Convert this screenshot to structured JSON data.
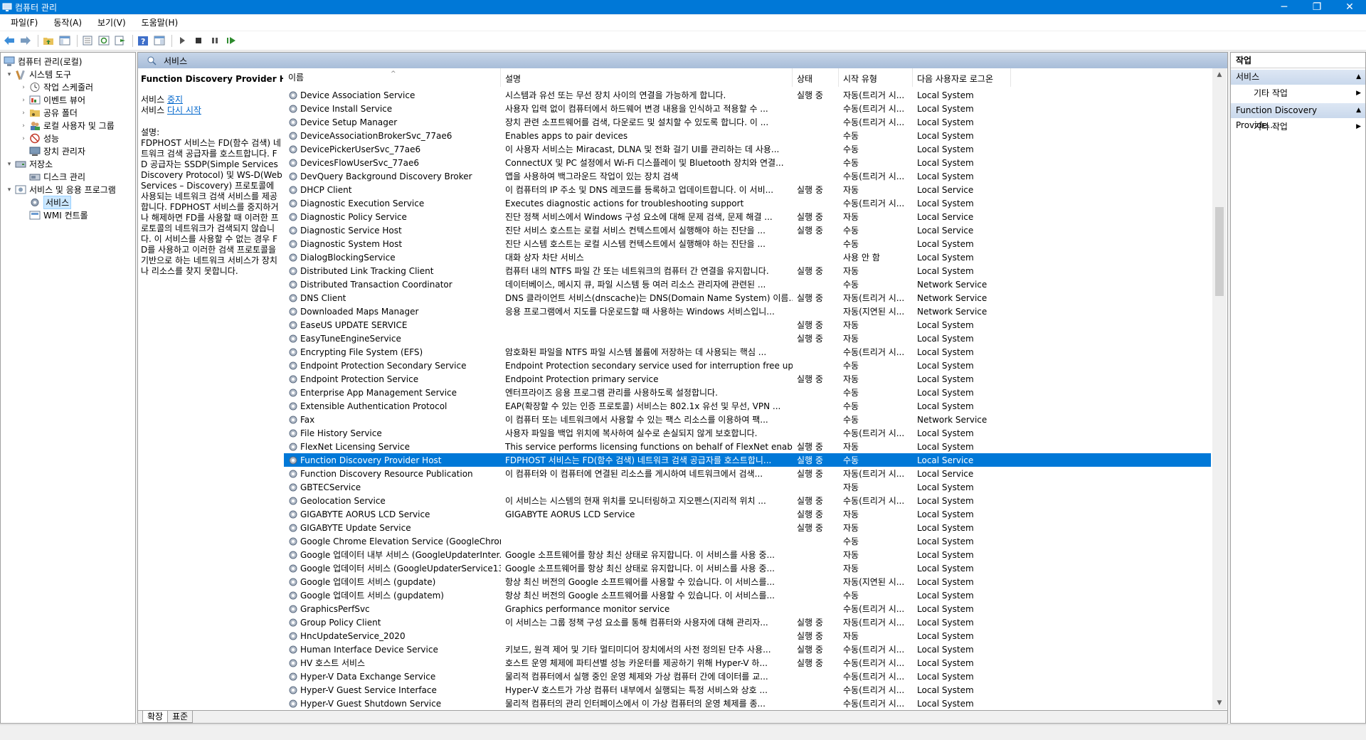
{
  "window": {
    "title": "컴퓨터 관리",
    "minimize": "─",
    "maximize": "❐",
    "close": "✕"
  },
  "menu": [
    "파일(F)",
    "동작(A)",
    "보기(V)",
    "도움말(H)"
  ],
  "tree": {
    "root": "컴퓨터 관리(로컬)",
    "system_tools": "시스템 도구",
    "task_scheduler": "작업 스케줄러",
    "event_viewer": "이벤트 뷰어",
    "shared_folders": "공유 폴더",
    "local_users": "로컬 사용자 및 그룹",
    "performance": "성능",
    "device_manager": "장치 관리자",
    "storage": "저장소",
    "disk_management": "디스크 관리",
    "services_apps": "서비스 및 응용 프로그램",
    "services": "서비스",
    "wmi": "WMI 컨트롤"
  },
  "center": {
    "header": "서비스",
    "selected_service": "Function Discovery Provider Host",
    "action_prefix_1": "서비스 ",
    "action_stop": "중지",
    "action_prefix_2": "서비스 ",
    "action_restart": "다시 시작",
    "desc_label": "설명:",
    "desc_text": "FDPHOST 서비스는 FD(함수 검색) 네트워크 검색 공급자를 호스트합니다. FD 공급자는 SSDP(Simple Services Discovery Protocol) 및 WS-D(Web Services – Discovery) 프로토콜에 사용되는 네트워크 검색 서비스를 제공합니다. FDPHOST 서비스를 중지하거나 해제하면 FD를 사용할 때 이러한 프로토콜의 네트워크가 검색되지 않습니다. 이 서비스를 사용할 수 없는 경우 FD를 사용하고 이러한 검색 프로토콜을 기반으로 하는 네트워크 서비스가 장치나 리소스를 찾지 못합니다.",
    "columns": [
      "이름",
      "설명",
      "상태",
      "시작 유형",
      "다음 사용자로 로그온"
    ],
    "sort_arrow": "^",
    "tabs": [
      "확장",
      "표준"
    ]
  },
  "services": [
    {
      "name": "Device Association Service",
      "desc": "시스템과 유선 또는 무선 장치 사이의 연결을 가능하게 합니다.",
      "status": "실행 중",
      "start": "자동(트리거 시...",
      "logon": "Local System"
    },
    {
      "name": "Device Install Service",
      "desc": "사용자 입력 없이 컴퓨터에서 하드웨어 변경 내용을 인식하고 적용할 수 ...",
      "status": "",
      "start": "수동(트리거 시...",
      "logon": "Local System"
    },
    {
      "name": "Device Setup Manager",
      "desc": "장치 관련 소프트웨어를 검색, 다운로드 및 설치할 수 있도록 합니다. 이 ...",
      "status": "",
      "start": "수동(트리거 시...",
      "logon": "Local System"
    },
    {
      "name": "DeviceAssociationBrokerSvc_77ae6",
      "desc": "Enables apps to pair devices",
      "status": "",
      "start": "수동",
      "logon": "Local System"
    },
    {
      "name": "DevicePickerUserSvc_77ae6",
      "desc": "이 사용자 서비스는 Miracast, DLNA 및 전화 걸기 UI를 관리하는 데 사용...",
      "status": "",
      "start": "수동",
      "logon": "Local System"
    },
    {
      "name": "DevicesFlowUserSvc_77ae6",
      "desc": "ConnectUX 및 PC 설정에서 Wi-Fi 디스플레이 및 Bluetooth 장치와 연결...",
      "status": "",
      "start": "수동",
      "logon": "Local System"
    },
    {
      "name": "DevQuery Background Discovery Broker",
      "desc": "앱을 사용하여 백그라운드 작업이 있는 장치 검색",
      "status": "",
      "start": "수동(트리거 시...",
      "logon": "Local System"
    },
    {
      "name": "DHCP Client",
      "desc": "이 컴퓨터의 IP 주소 및 DNS 레코드를 등록하고 업데이트합니다. 이 서비...",
      "status": "실행 중",
      "start": "자동",
      "logon": "Local Service"
    },
    {
      "name": "Diagnostic Execution Service",
      "desc": "Executes diagnostic actions for troubleshooting support",
      "status": "",
      "start": "수동(트리거 시...",
      "logon": "Local System"
    },
    {
      "name": "Diagnostic Policy Service",
      "desc": "진단 정책 서비스에서 Windows 구성 요소에 대해 문제 검색, 문제 해결 ...",
      "status": "실행 중",
      "start": "자동",
      "logon": "Local Service"
    },
    {
      "name": "Diagnostic Service Host",
      "desc": "진단 서비스 호스트는 로컬 서비스 컨텍스트에서 실행해야 하는 진단을 ...",
      "status": "실행 중",
      "start": "수동",
      "logon": "Local Service"
    },
    {
      "name": "Diagnostic System Host",
      "desc": "진단 시스템 호스트는 로컬 시스템 컨텍스트에서 실행해야 하는 진단을 ...",
      "status": "",
      "start": "수동",
      "logon": "Local System"
    },
    {
      "name": "DialogBlockingService",
      "desc": "대화 상자 차단 서비스",
      "status": "",
      "start": "사용 안 함",
      "logon": "Local System"
    },
    {
      "name": "Distributed Link Tracking Client",
      "desc": "컴퓨터 내의 NTFS 파일 간 또는 네트워크의 컴퓨터 간 연결을 유지합니다.",
      "status": "실행 중",
      "start": "자동",
      "logon": "Local System"
    },
    {
      "name": "Distributed Transaction Coordinator",
      "desc": "데이터베이스, 메시지 큐, 파일 시스템 등 여러 리소스 관리자에 관련된 ...",
      "status": "",
      "start": "수동",
      "logon": "Network Service"
    },
    {
      "name": "DNS Client",
      "desc": "DNS 클라이언트 서비스(dnscache)는 DNS(Domain Name System) 이름...",
      "status": "실행 중",
      "start": "자동(트리거 시...",
      "logon": "Network Service"
    },
    {
      "name": "Downloaded Maps Manager",
      "desc": "응용 프로그램에서 지도를 다운로드할 때 사용하는 Windows 서비스입니...",
      "status": "",
      "start": "자동(지연된 시...",
      "logon": "Network Service"
    },
    {
      "name": "EaseUS UPDATE SERVICE",
      "desc": "",
      "status": "실행 중",
      "start": "자동",
      "logon": "Local System"
    },
    {
      "name": "EasyTuneEngineService",
      "desc": "",
      "status": "실행 중",
      "start": "자동",
      "logon": "Local System"
    },
    {
      "name": "Encrypting File System (EFS)",
      "desc": "암호화된 파일을 NTFS 파일 시스템 볼륨에 저장하는 데 사용되는 핵심 ...",
      "status": "",
      "start": "수동(트리거 시...",
      "logon": "Local System"
    },
    {
      "name": "Endpoint Protection Secondary Service",
      "desc": "Endpoint Protection secondary service used for interruption free updates",
      "status": "",
      "start": "수동",
      "logon": "Local System"
    },
    {
      "name": "Endpoint Protection Service",
      "desc": "Endpoint Protection primary service",
      "status": "실행 중",
      "start": "자동",
      "logon": "Local System"
    },
    {
      "name": "Enterprise App Management Service",
      "desc": "엔터프라이즈 응용 프로그램 관리를 사용하도록 설정합니다.",
      "status": "",
      "start": "수동",
      "logon": "Local System"
    },
    {
      "name": "Extensible Authentication Protocol",
      "desc": "EAP(확장할 수 있는 인증 프로토콜) 서비스는 802.1x 유선 및 무선, VPN ...",
      "status": "",
      "start": "수동",
      "logon": "Local System"
    },
    {
      "name": "Fax",
      "desc": "이 컴퓨터 또는 네트워크에서 사용할 수 있는 팩스 리소스를 이용하여 팩...",
      "status": "",
      "start": "수동",
      "logon": "Network Service"
    },
    {
      "name": "File History Service",
      "desc": "사용자 파일을 백업 위치에 복사하여 실수로 손실되지 않게 보호합니다.",
      "status": "",
      "start": "수동(트리거 시...",
      "logon": "Local System"
    },
    {
      "name": "FlexNet Licensing Service",
      "desc": "This service performs licensing functions on behalf of FlexNet enabled p...",
      "status": "실행 중",
      "start": "자동",
      "logon": "Local System"
    },
    {
      "name": "Function Discovery Provider Host",
      "desc": "FDPHOST 서비스는 FD(함수 검색) 네트워크 검색 공급자를 호스트합니...",
      "status": "실행 중",
      "start": "수동",
      "logon": "Local Service",
      "selected": true
    },
    {
      "name": "Function Discovery Resource Publication",
      "desc": "이 컴퓨터와 이 컴퓨터에 연결된 리소스를 게시하여 네트워크에서 검색...",
      "status": "실행 중",
      "start": "자동(트리거 시...",
      "logon": "Local Service"
    },
    {
      "name": "GBTECService",
      "desc": "",
      "status": "",
      "start": "자동",
      "logon": "Local System"
    },
    {
      "name": "Geolocation Service",
      "desc": "이 서비스는 시스템의 현재 위치를 모니터링하고 지오펜스(지리적 위치 ...",
      "status": "실행 중",
      "start": "수동(트리거 시...",
      "logon": "Local System"
    },
    {
      "name": "GIGABYTE AORUS LCD Service",
      "desc": "GIGABYTE AORUS LCD Service",
      "status": "실행 중",
      "start": "자동",
      "logon": "Local System"
    },
    {
      "name": "GIGABYTE Update Service",
      "desc": "",
      "status": "실행 중",
      "start": "자동",
      "logon": "Local System"
    },
    {
      "name": "Google Chrome Elevation Service (GoogleChromeE...",
      "desc": "",
      "status": "",
      "start": "수동",
      "logon": "Local System"
    },
    {
      "name": "Google 업데이터 내부 서비스 (GoogleUpdaterInter...",
      "desc": "Google 소프트웨어를 항상 최신 상태로 유지합니다. 이 서비스를 사용 중...",
      "status": "",
      "start": "자동",
      "logon": "Local System"
    },
    {
      "name": "Google 업데이터 서비스 (GoogleUpdaterService13...",
      "desc": "Google 소프트웨어를 항상 최신 상태로 유지합니다. 이 서비스를 사용 중...",
      "status": "",
      "start": "자동",
      "logon": "Local System"
    },
    {
      "name": "Google 업데이트 서비스 (gupdate)",
      "desc": "항상 최신 버전의 Google 소프트웨어를 사용할 수 있습니다. 이 서비스를...",
      "status": "",
      "start": "자동(지연된 시...",
      "logon": "Local System"
    },
    {
      "name": "Google 업데이트 서비스 (gupdatem)",
      "desc": "항상 최신 버전의 Google 소프트웨어를 사용할 수 있습니다. 이 서비스를...",
      "status": "",
      "start": "수동",
      "logon": "Local System"
    },
    {
      "name": "GraphicsPerfSvc",
      "desc": "Graphics performance monitor service",
      "status": "",
      "start": "수동(트리거 시...",
      "logon": "Local System"
    },
    {
      "name": "Group Policy Client",
      "desc": "이 서비스는 그룹 정책 구성 요소를 통해 컴퓨터와 사용자에 대해 관리자...",
      "status": "실행 중",
      "start": "자동(트리거 시...",
      "logon": "Local System"
    },
    {
      "name": "HncUpdateService_2020",
      "desc": "",
      "status": "실행 중",
      "start": "자동",
      "logon": "Local System"
    },
    {
      "name": "Human Interface Device Service",
      "desc": "키보드, 원격 제어 및 기타 멀티미디어 장치에서의 사전 정의된 단추 사용...",
      "status": "실행 중",
      "start": "수동(트리거 시...",
      "logon": "Local System"
    },
    {
      "name": "HV 호스트 서비스",
      "desc": "호스트 운영 체제에 파티션별 성능 카운터를 제공하기 위해 Hyper-V 하...",
      "status": "실행 중",
      "start": "수동(트리거 시...",
      "logon": "Local System"
    },
    {
      "name": "Hyper-V Data Exchange Service",
      "desc": "물리적 컴퓨터에서 실행 중인 운영 체제와 가상 컴퓨터 간에 데이터를 교...",
      "status": "",
      "start": "수동(트리거 시...",
      "logon": "Local System"
    },
    {
      "name": "Hyper-V Guest Service Interface",
      "desc": "Hyper-V 호스트가 가상 컴퓨터 내부에서 실행되는 특정 서비스와 상호 ...",
      "status": "",
      "start": "수동(트리거 시...",
      "logon": "Local System"
    },
    {
      "name": "Hyper-V Guest Shutdown Service",
      "desc": "물리적 컴퓨터의 관리 인터페이스에서 이 가상 컴퓨터의 운영 체제를 종...",
      "status": "",
      "start": "수동(트리거 시...",
      "logon": "Local System"
    }
  ],
  "actions": {
    "title": "작업",
    "section1": "서비스",
    "more1": "기타 작업",
    "section2": "Function Discovery Provide...",
    "more2": "기타 작업"
  },
  "colors": {
    "titlebar": "#0078d7",
    "selection": "#0078d7",
    "link": "#0066cc"
  }
}
